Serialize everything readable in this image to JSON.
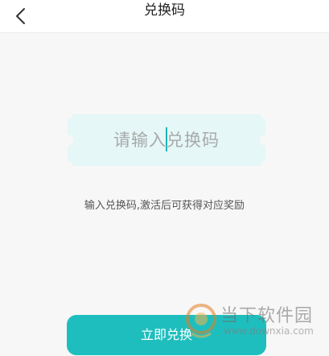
{
  "header": {
    "title": "兑换码"
  },
  "redeem": {
    "placeholder": "请输入兑换码",
    "hint": "输入兑换码,激活后可获得对应奖励",
    "button_label": "立即兑换"
  },
  "watermark": {
    "name": "当下软件园",
    "url": "www.downxia.com"
  },
  "colors": {
    "accent": "#1fbebe",
    "ticket_bg": "#e5f7f7"
  }
}
